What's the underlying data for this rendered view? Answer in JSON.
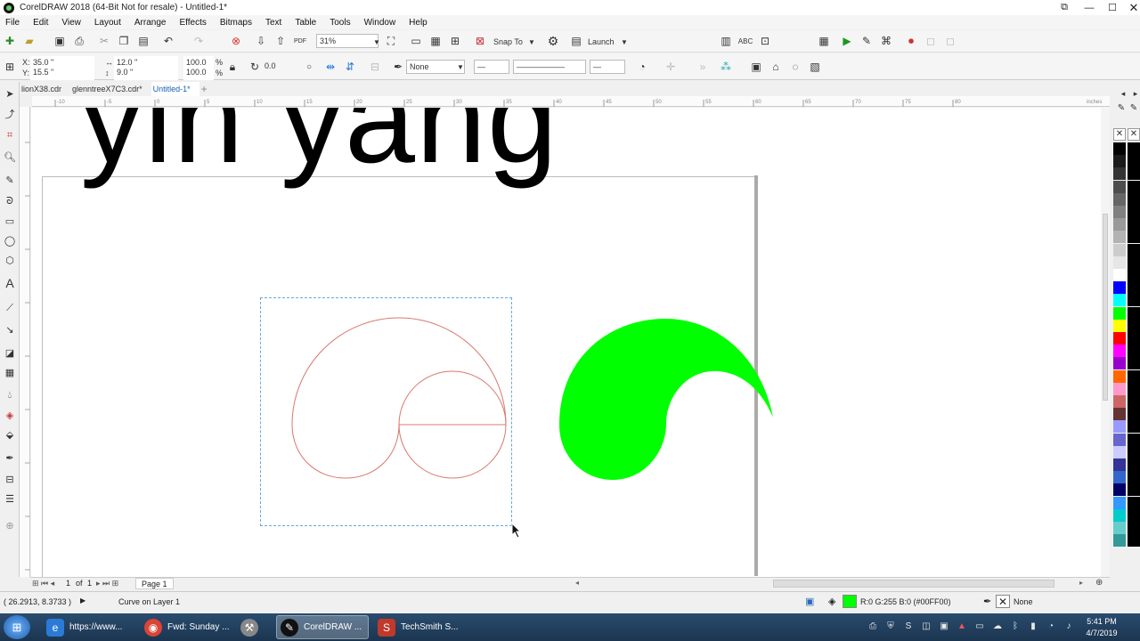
{
  "window": {
    "title": "CorelDRAW 2018 (64-Bit Not for resale) - Untitled-1*",
    "controls": [
      "restore-icon",
      "minimize-icon",
      "maximize-icon",
      "close-icon"
    ]
  },
  "menu": [
    "File",
    "Edit",
    "View",
    "Layout",
    "Arrange",
    "Effects",
    "Bitmaps",
    "Text",
    "Table",
    "Tools",
    "Window",
    "Help"
  ],
  "toolbar1": {
    "zoom": "31%",
    "snap_to": "Snap To",
    "launch": "Launch"
  },
  "toolbar2": {
    "x": "35.0 \"",
    "y": "15.5 \"",
    "width": "12.0 \"",
    "height": "9.0 \"",
    "scale_w": "100.0",
    "scale_h": "100.0",
    "percent": "%",
    "angle": "0.0",
    "outline_none": "None"
  },
  "doc_tabs": [
    {
      "label": "lionX38.cdr",
      "active": false
    },
    {
      "label": "glenntreeX7C3.cdr*",
      "active": false
    },
    {
      "label": "Untitled-1*",
      "active": true
    }
  ],
  "ruler": {
    "unit_label": "inches",
    "ticks": [
      "-10",
      "-5",
      "0",
      "5",
      "10",
      "15",
      "20",
      "25",
      "30",
      "35",
      "40",
      "45",
      "50",
      "55",
      "60",
      "65",
      "70",
      "75",
      "80"
    ]
  },
  "canvas": {
    "big_text": "yin yang",
    "shape_fill": "#00FF00",
    "curve_color": "#d9776f"
  },
  "palette": [
    "#000000",
    "#1a1a1a",
    "#333333",
    "#4d4d4d",
    "#666666",
    "#808080",
    "#999999",
    "#b3b3b3",
    "#cccccc",
    "#e6e6e6",
    "#ffffff",
    "#0000ff",
    "#00ffff",
    "#00ff00",
    "#ffff00",
    "#ff0000",
    "#ff00ff",
    "#9900cc",
    "#ff6600",
    "#ff99cc",
    "#cc6666",
    "#663333",
    "#9999ff",
    "#6666cc",
    "#ccccff",
    "#333399",
    "#3366cc",
    "#000066",
    "#3399ff",
    "#00cccc",
    "#66cccc",
    "#339999"
  ],
  "pagebar": {
    "page_of": "1",
    "of_label": "of",
    "total": "1",
    "page_tab": "Page 1"
  },
  "status": {
    "coords": "( 26.2913, 8.3733 )",
    "layer": "Curve on Layer 1",
    "fill_info": "R:0 G:255 B:0 (#00FF00)",
    "fill_color": "#00FF00",
    "outline": "None"
  },
  "taskbar": {
    "tasks": [
      {
        "label": "https://www...",
        "icon": "ie-icon",
        "color": "#2b7bd6"
      },
      {
        "label": "Fwd: Sunday ...",
        "icon": "chrome-icon",
        "color": "#db4437"
      },
      {
        "label": "",
        "icon": "tool-icon",
        "color": "#888888"
      },
      {
        "label": "CorelDRAW ...",
        "icon": "coreldraw-icon",
        "color": "#111111"
      },
      {
        "label": "TechSmith S...",
        "icon": "techsmith-icon",
        "color": "#c0392b"
      }
    ],
    "time": "5:41 PM",
    "date": "4/7/2019"
  }
}
